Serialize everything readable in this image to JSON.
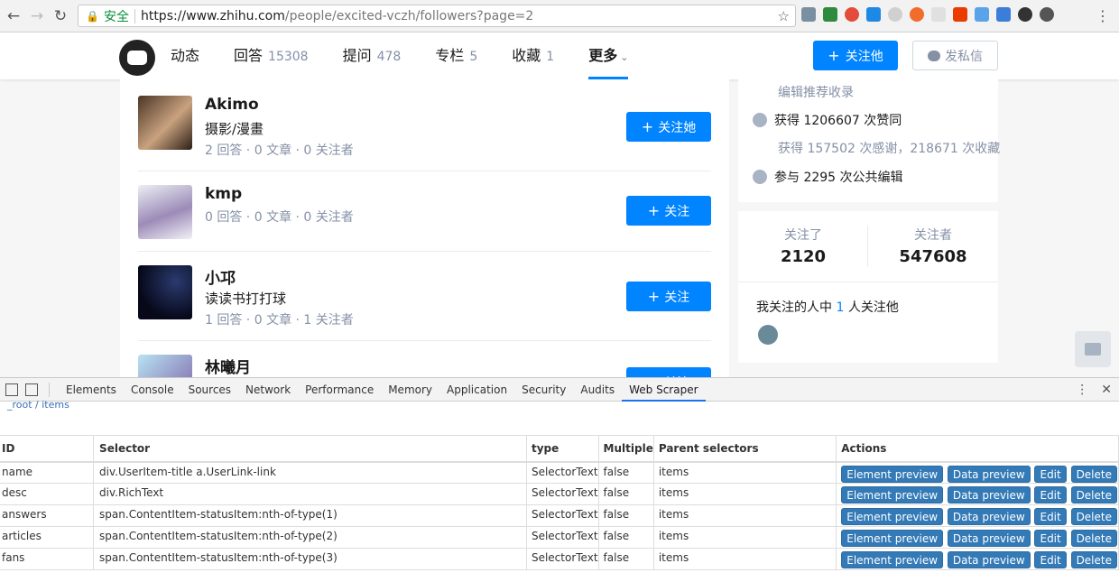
{
  "browser": {
    "secure_label": "安全",
    "url_base": "https://www.zhihu.com",
    "url_rest": "/people/excited-vczh/followers?page=2"
  },
  "header": {
    "tabs": [
      {
        "label": "动态",
        "count": ""
      },
      {
        "label": "回答",
        "count": "15308"
      },
      {
        "label": "提问",
        "count": "478"
      },
      {
        "label": "专栏",
        "count": "5"
      },
      {
        "label": "收藏",
        "count": "1"
      },
      {
        "label": "更多",
        "count": ""
      }
    ],
    "follow_label": "关注他",
    "message_label": "发私信"
  },
  "users": [
    {
      "name": "Akimo",
      "desc": "摄影/漫畫",
      "stats": "2 回答 · 0 文章 · 0 关注者",
      "follow": "关注她"
    },
    {
      "name": "kmp",
      "desc": "",
      "stats": "0 回答 · 0 文章 · 0 关注者",
      "follow": "关注"
    },
    {
      "name": "小邛",
      "desc": "读读书打打球",
      "stats": "1 回答 · 0 文章 · 1 关注者",
      "follow": "关注"
    },
    {
      "name": "林曦月",
      "desc": "",
      "stats": "",
      "follow": "关注"
    }
  ],
  "sidebar": {
    "recommend": "编辑推荐收录",
    "likes": "获得 1206607 次赞同",
    "thanks": "获得 157502 次感谢，218671 次收藏",
    "edits": "参与 2295 次公共编辑",
    "following_label": "关注了",
    "following_value": "2120",
    "followers_label": "关注者",
    "followers_value": "547608",
    "mutual_prefix": "我关注的人中",
    "mutual_count": "1",
    "mutual_suffix": "人关注他"
  },
  "devtools": {
    "tabs": [
      "Elements",
      "Console",
      "Sources",
      "Network",
      "Performance",
      "Memory",
      "Application",
      "Security",
      "Audits",
      "Web Scraper"
    ],
    "active_tab": "Web Scraper",
    "breadcrumb": "_root / items",
    "columns": [
      "ID",
      "Selector",
      "type",
      "Multiple",
      "Parent selectors",
      "Actions"
    ],
    "rows": [
      {
        "id": "name",
        "selector": "div.UserItem-title a.UserLink-link",
        "type": "SelectorText",
        "multiple": "false",
        "parent": "items"
      },
      {
        "id": "desc",
        "selector": "div.RichText",
        "type": "SelectorText",
        "multiple": "false",
        "parent": "items"
      },
      {
        "id": "answers",
        "selector": "span.ContentItem-statusItem:nth-of-type(1)",
        "type": "SelectorText",
        "multiple": "false",
        "parent": "items"
      },
      {
        "id": "articles",
        "selector": "span.ContentItem-statusItem:nth-of-type(2)",
        "type": "SelectorText",
        "multiple": "false",
        "parent": "items"
      },
      {
        "id": "fans",
        "selector": "span.ContentItem-statusItem:nth-of-type(3)",
        "type": "SelectorText",
        "multiple": "false",
        "parent": "items"
      }
    ],
    "actions": [
      "Element preview",
      "Data preview",
      "Edit",
      "Delete"
    ]
  }
}
